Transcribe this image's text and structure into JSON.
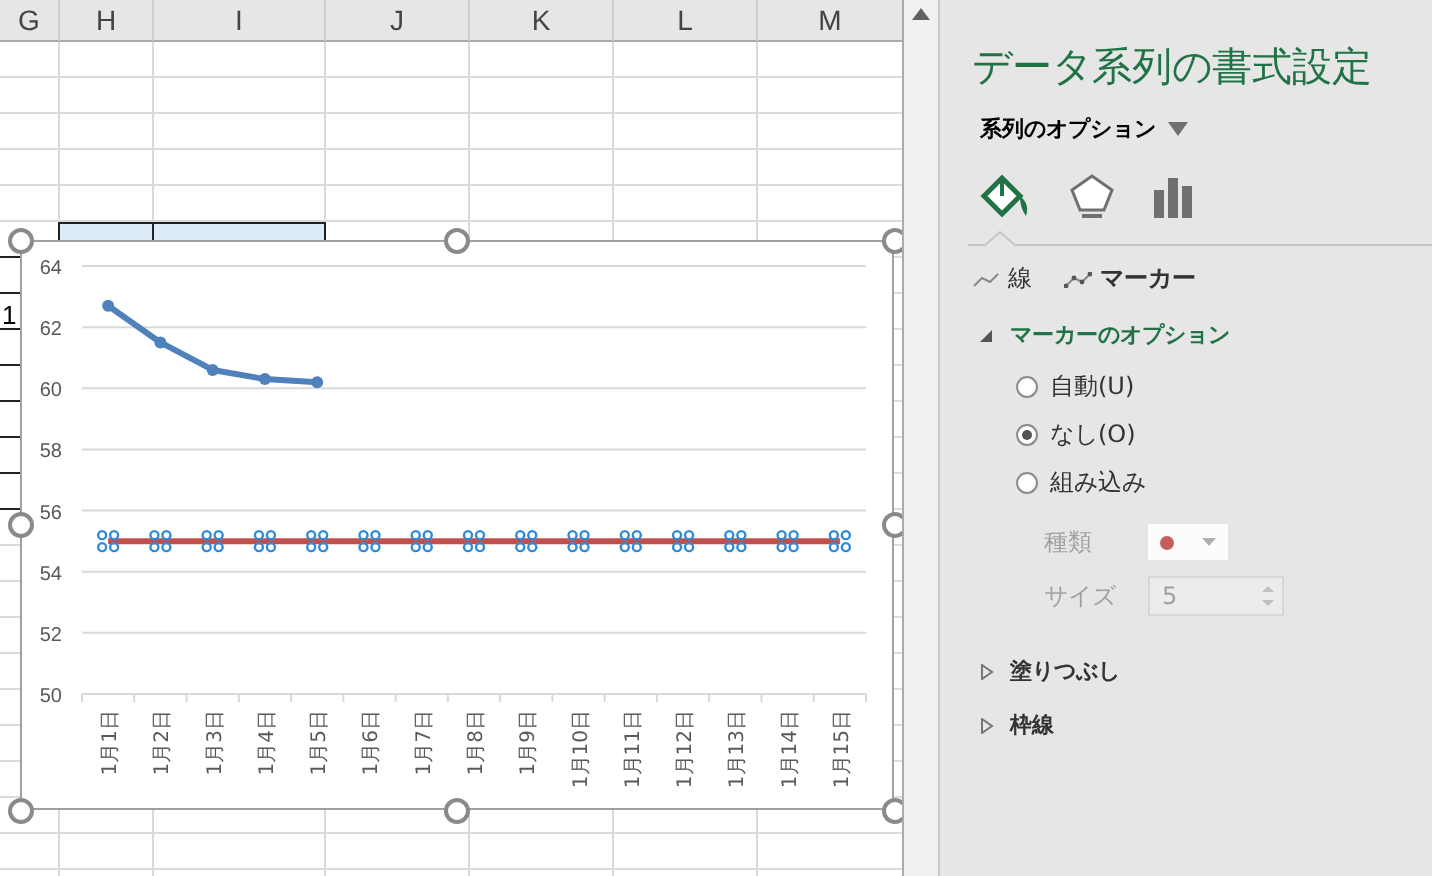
{
  "sheet": {
    "columns": [
      "G",
      "H",
      "I",
      "J",
      "K",
      "L",
      "M"
    ],
    "partial_cells": [
      {
        "text": "1"
      }
    ]
  },
  "chart": {
    "selected": true,
    "series_states": [
      {
        "selected": false
      },
      {
        "selected": true
      }
    ],
    "chart_data": {
      "type": "line",
      "grid": true,
      "categories": [
        "1月1日",
        "1月2日",
        "1月3日",
        "1月4日",
        "1月5日",
        "1月6日",
        "1月7日",
        "1月8日",
        "1月9日",
        "1月10日",
        "1月11日",
        "1月12日",
        "1月13日",
        "1月14日",
        "1月15日"
      ],
      "series": [
        {
          "color": "#4f81bd",
          "marker": true,
          "values": [
            62.7,
            61.5,
            60.6,
            60.3,
            60.2,
            null,
            null,
            null,
            null,
            null,
            null,
            null,
            null,
            null,
            null
          ]
        },
        {
          "color": "#c0504d",
          "marker": false,
          "values": [
            55,
            55,
            55,
            55,
            55,
            55,
            55,
            55,
            55,
            55,
            55,
            55,
            55,
            55,
            55
          ]
        }
      ],
      "ylim": [
        50,
        64
      ],
      "yticks": [
        50,
        52,
        54,
        56,
        58,
        60,
        62,
        64
      ]
    }
  },
  "panel": {
    "title": "データ系列の書式設定",
    "options_label": "系列のオプション",
    "icon_tabs": [
      {
        "kind": "fill",
        "selected": true
      },
      {
        "kind": "effects",
        "selected": false
      },
      {
        "kind": "series",
        "selected": false
      }
    ],
    "tabs": [
      {
        "kind": "line",
        "label": "線",
        "selected": false
      },
      {
        "kind": "marker",
        "label": "マーカー",
        "selected": true
      }
    ],
    "sections": [
      {
        "title": "マーカーのオプション",
        "expanded": true,
        "radios": [
          {
            "label": "自動(U)",
            "selected": false
          },
          {
            "label": "なし(O)",
            "selected": true
          },
          {
            "label": "組み込み",
            "selected": false
          }
        ],
        "type_field": {
          "label": "種類",
          "color": "#c0504d",
          "disabled": true
        },
        "size_field": {
          "label": "サイズ",
          "value": "5",
          "disabled": true
        }
      },
      {
        "title": "塗りつぶし",
        "expanded": false
      },
      {
        "title": "枠線",
        "expanded": false
      }
    ]
  }
}
